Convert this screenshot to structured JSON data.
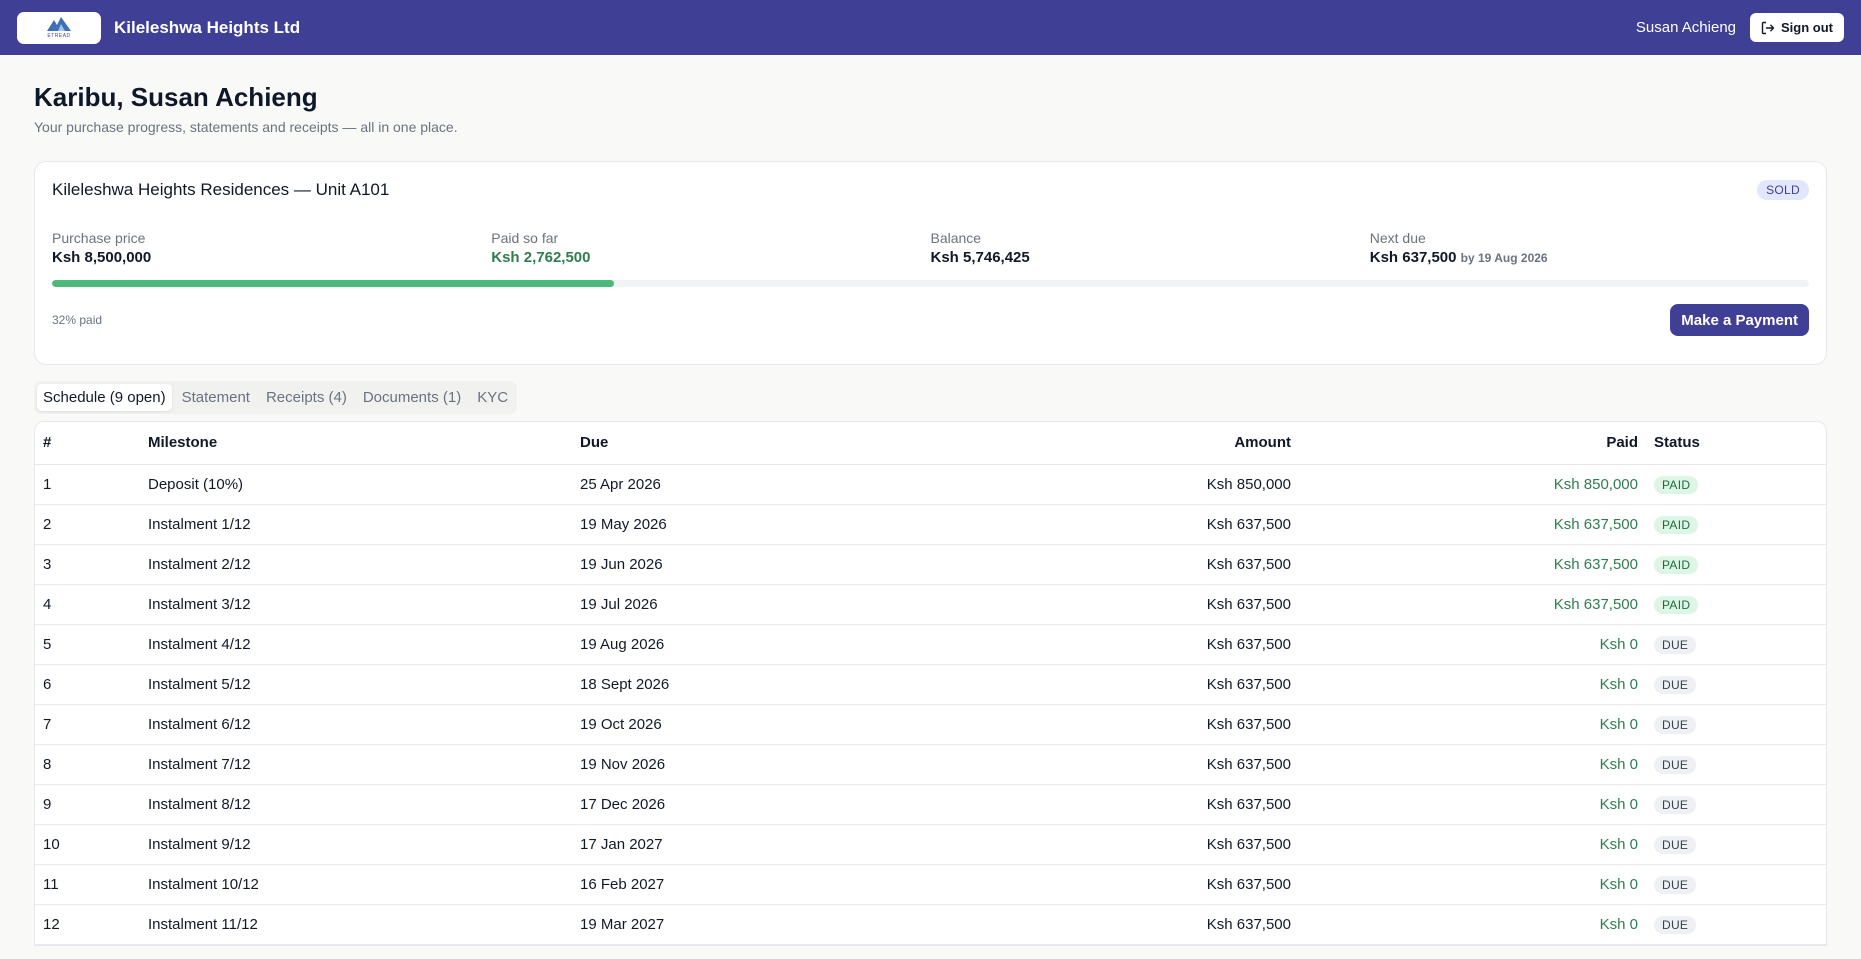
{
  "header": {
    "logo_text": "ETREAD",
    "company": "Kileleshwa Heights Ltd",
    "user_name": "Susan Achieng",
    "signout_label": "Sign out"
  },
  "page": {
    "greeting": "Karibu, Susan Achieng",
    "subtitle": "Your purchase progress, statements and receipts — all in one place."
  },
  "summary": {
    "unit_title": "Kileleshwa Heights Residences — Unit A101",
    "status_badge": "SOLD",
    "purchase_price_label": "Purchase price",
    "purchase_price": "Ksh 8,500,000",
    "paid_label": "Paid so far",
    "paid": "Ksh 2,762,500",
    "balance_label": "Balance",
    "balance": "Ksh 5,746,425",
    "next_due_label": "Next due",
    "next_due": "Ksh 637,500",
    "next_due_date": "by 19 Aug 2026",
    "progress_fraction": 0.32,
    "progress_text": "32% paid",
    "pay_button": "Make a Payment"
  },
  "tabs": [
    {
      "label": "Schedule (9 open)",
      "active": true
    },
    {
      "label": "Statement",
      "active": false
    },
    {
      "label": "Receipts (4)",
      "active": false
    },
    {
      "label": "Documents (1)",
      "active": false
    },
    {
      "label": "KYC",
      "active": false
    }
  ],
  "table": {
    "headers": [
      "#",
      "Milestone",
      "Due",
      "Amount",
      "Paid",
      "Status"
    ],
    "rows": [
      [
        "1",
        "Deposit (10%)",
        "25 Apr 2026",
        "Ksh 850,000",
        "Ksh 850,000",
        "PAID"
      ],
      [
        "2",
        "Instalment 1/12",
        "19 May 2026",
        "Ksh 637,500",
        "Ksh 637,500",
        "PAID"
      ],
      [
        "3",
        "Instalment 2/12",
        "19 Jun 2026",
        "Ksh 637,500",
        "Ksh 637,500",
        "PAID"
      ],
      [
        "4",
        "Instalment 3/12",
        "19 Jul 2026",
        "Ksh 637,500",
        "Ksh 637,500",
        "PAID"
      ],
      [
        "5",
        "Instalment 4/12",
        "19 Aug 2026",
        "Ksh 637,500",
        "Ksh 0",
        "DUE"
      ],
      [
        "6",
        "Instalment 5/12",
        "18 Sept 2026",
        "Ksh 637,500",
        "Ksh 0",
        "DUE"
      ],
      [
        "7",
        "Instalment 6/12",
        "19 Oct 2026",
        "Ksh 637,500",
        "Ksh 0",
        "DUE"
      ],
      [
        "8",
        "Instalment 7/12",
        "19 Nov 2026",
        "Ksh 637,500",
        "Ksh 0",
        "DUE"
      ],
      [
        "9",
        "Instalment 8/12",
        "17 Dec 2026",
        "Ksh 637,500",
        "Ksh 0",
        "DUE"
      ],
      [
        "10",
        "Instalment 9/12",
        "17 Jan 2027",
        "Ksh 637,500",
        "Ksh 0",
        "DUE"
      ],
      [
        "11",
        "Instalment 10/12",
        "16 Feb 2027",
        "Ksh 637,500",
        "Ksh 0",
        "DUE"
      ],
      [
        "12",
        "Instalment 11/12",
        "19 Mar 2027",
        "Ksh 637,500",
        "Ksh 0",
        "DUE"
      ]
    ]
  }
}
